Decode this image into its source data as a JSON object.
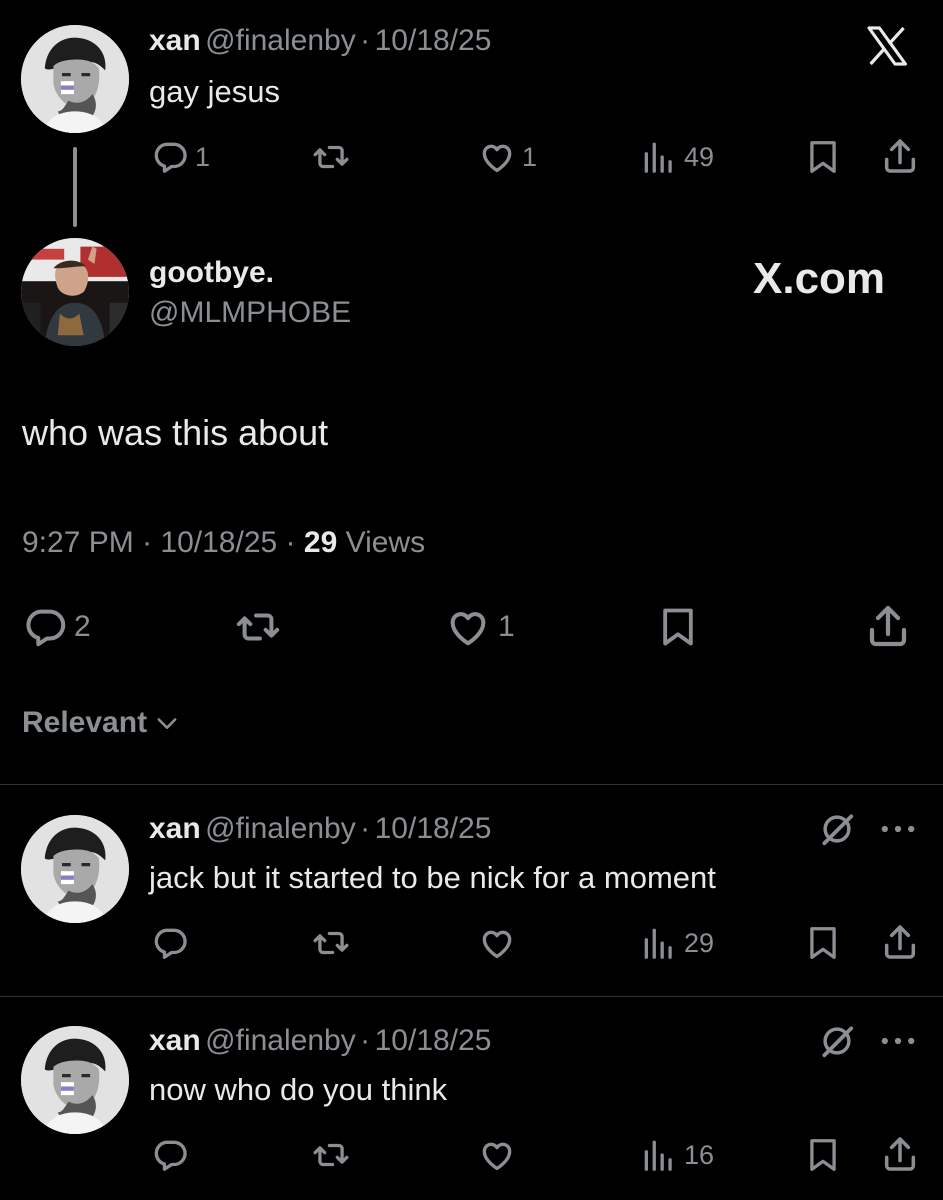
{
  "tweet1": {
    "name": "xan",
    "handle": "@finalenby",
    "sep": "·",
    "date": "10/18/25",
    "text": "gay jesus",
    "replies": "1",
    "likes": "1",
    "views": "49"
  },
  "main": {
    "name": "gootbye.",
    "handle": "@MLMPHOBE",
    "brand": "X.com",
    "text": "who was this about",
    "time": "9:27 PM",
    "sep": "·",
    "date": "10/18/25",
    "views_count": "29",
    "views_label": "Views",
    "replies": "2",
    "likes": "1"
  },
  "sort": {
    "label": "Relevant"
  },
  "reply1": {
    "name": "xan",
    "handle": "@finalenby",
    "sep": "·",
    "date": "10/18/25",
    "text": "jack but it started to be nick for a moment",
    "views": "29"
  },
  "reply2": {
    "name": "xan",
    "handle": "@finalenby",
    "sep": "·",
    "date": "10/18/25",
    "text": "now who do you think",
    "views": "16"
  },
  "colors": {
    "bg": "#000000",
    "text": "#e7e9ea",
    "muted": "#8b8f94",
    "divider": "#2f3336"
  },
  "icons": [
    "x-logo-icon",
    "reply-icon",
    "retweet-icon",
    "like-icon",
    "views-icon",
    "bookmark-icon",
    "share-icon",
    "chevron-down-icon",
    "grok-icon",
    "more-icon"
  ]
}
